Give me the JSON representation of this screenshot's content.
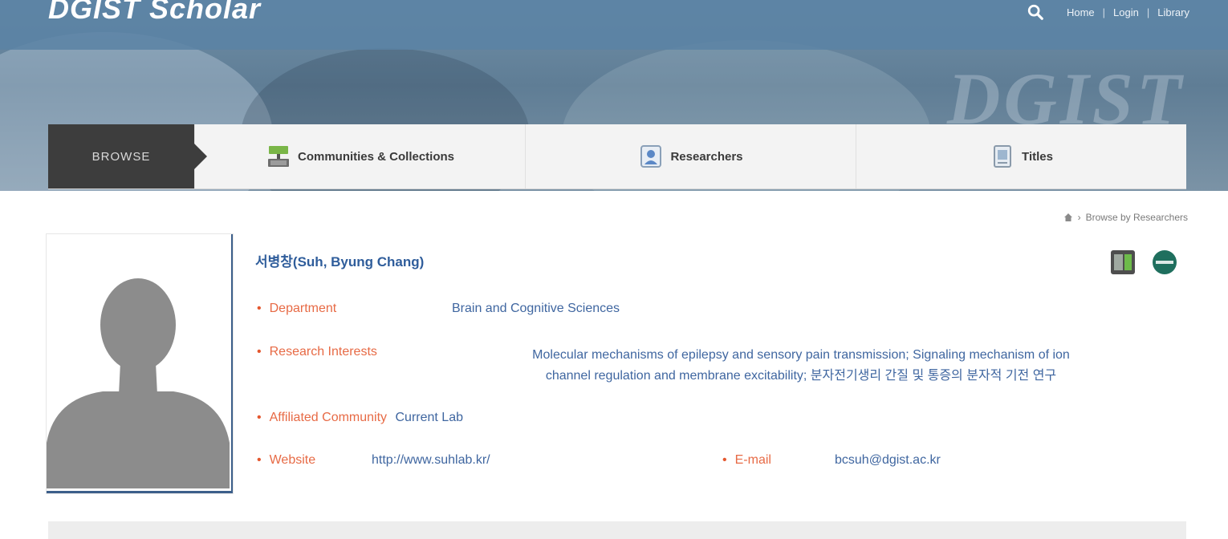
{
  "header": {
    "logo_text": "DGIST Scholar",
    "nav": [
      "Home",
      "Login",
      "Library"
    ],
    "search_icon": "search-icon"
  },
  "tabs": {
    "browse_label": "BROWSE",
    "items": [
      {
        "label": "Communities & Collections",
        "icon": "communities-icon"
      },
      {
        "label": "Researchers",
        "icon": "researcher-icon"
      },
      {
        "label": "Titles",
        "icon": "titles-icon"
      }
    ]
  },
  "breadcrumb": {
    "home_icon": "home-icon",
    "current": "Browse by Researchers"
  },
  "profile": {
    "name": "서병창(Suh, Byung Chang)",
    "department_label": "Department",
    "department_value": "Brain and Cognitive Sciences",
    "research_label": "Research Interests",
    "research_line1": "Molecular mechanisms of epilepsy and sensory pain transmission; Signaling mechanism of ion",
    "research_line2": "channel regulation and membrane excitability; 분자전기생리 간질 및 통증의 분자적 기전 연구",
    "affiliated_label": "Affiliated Community",
    "affiliated_value": "Current Lab",
    "website_label": "Website",
    "website_value": "http://www.suhlab.kr/",
    "email_label": "E-mail",
    "email_value": "bcsuh@dgist.ac.kr"
  },
  "colors": {
    "accent_blue": "#2f5d9b",
    "label_orange": "#e76a45",
    "tab_dark": "#3d3d3d"
  }
}
